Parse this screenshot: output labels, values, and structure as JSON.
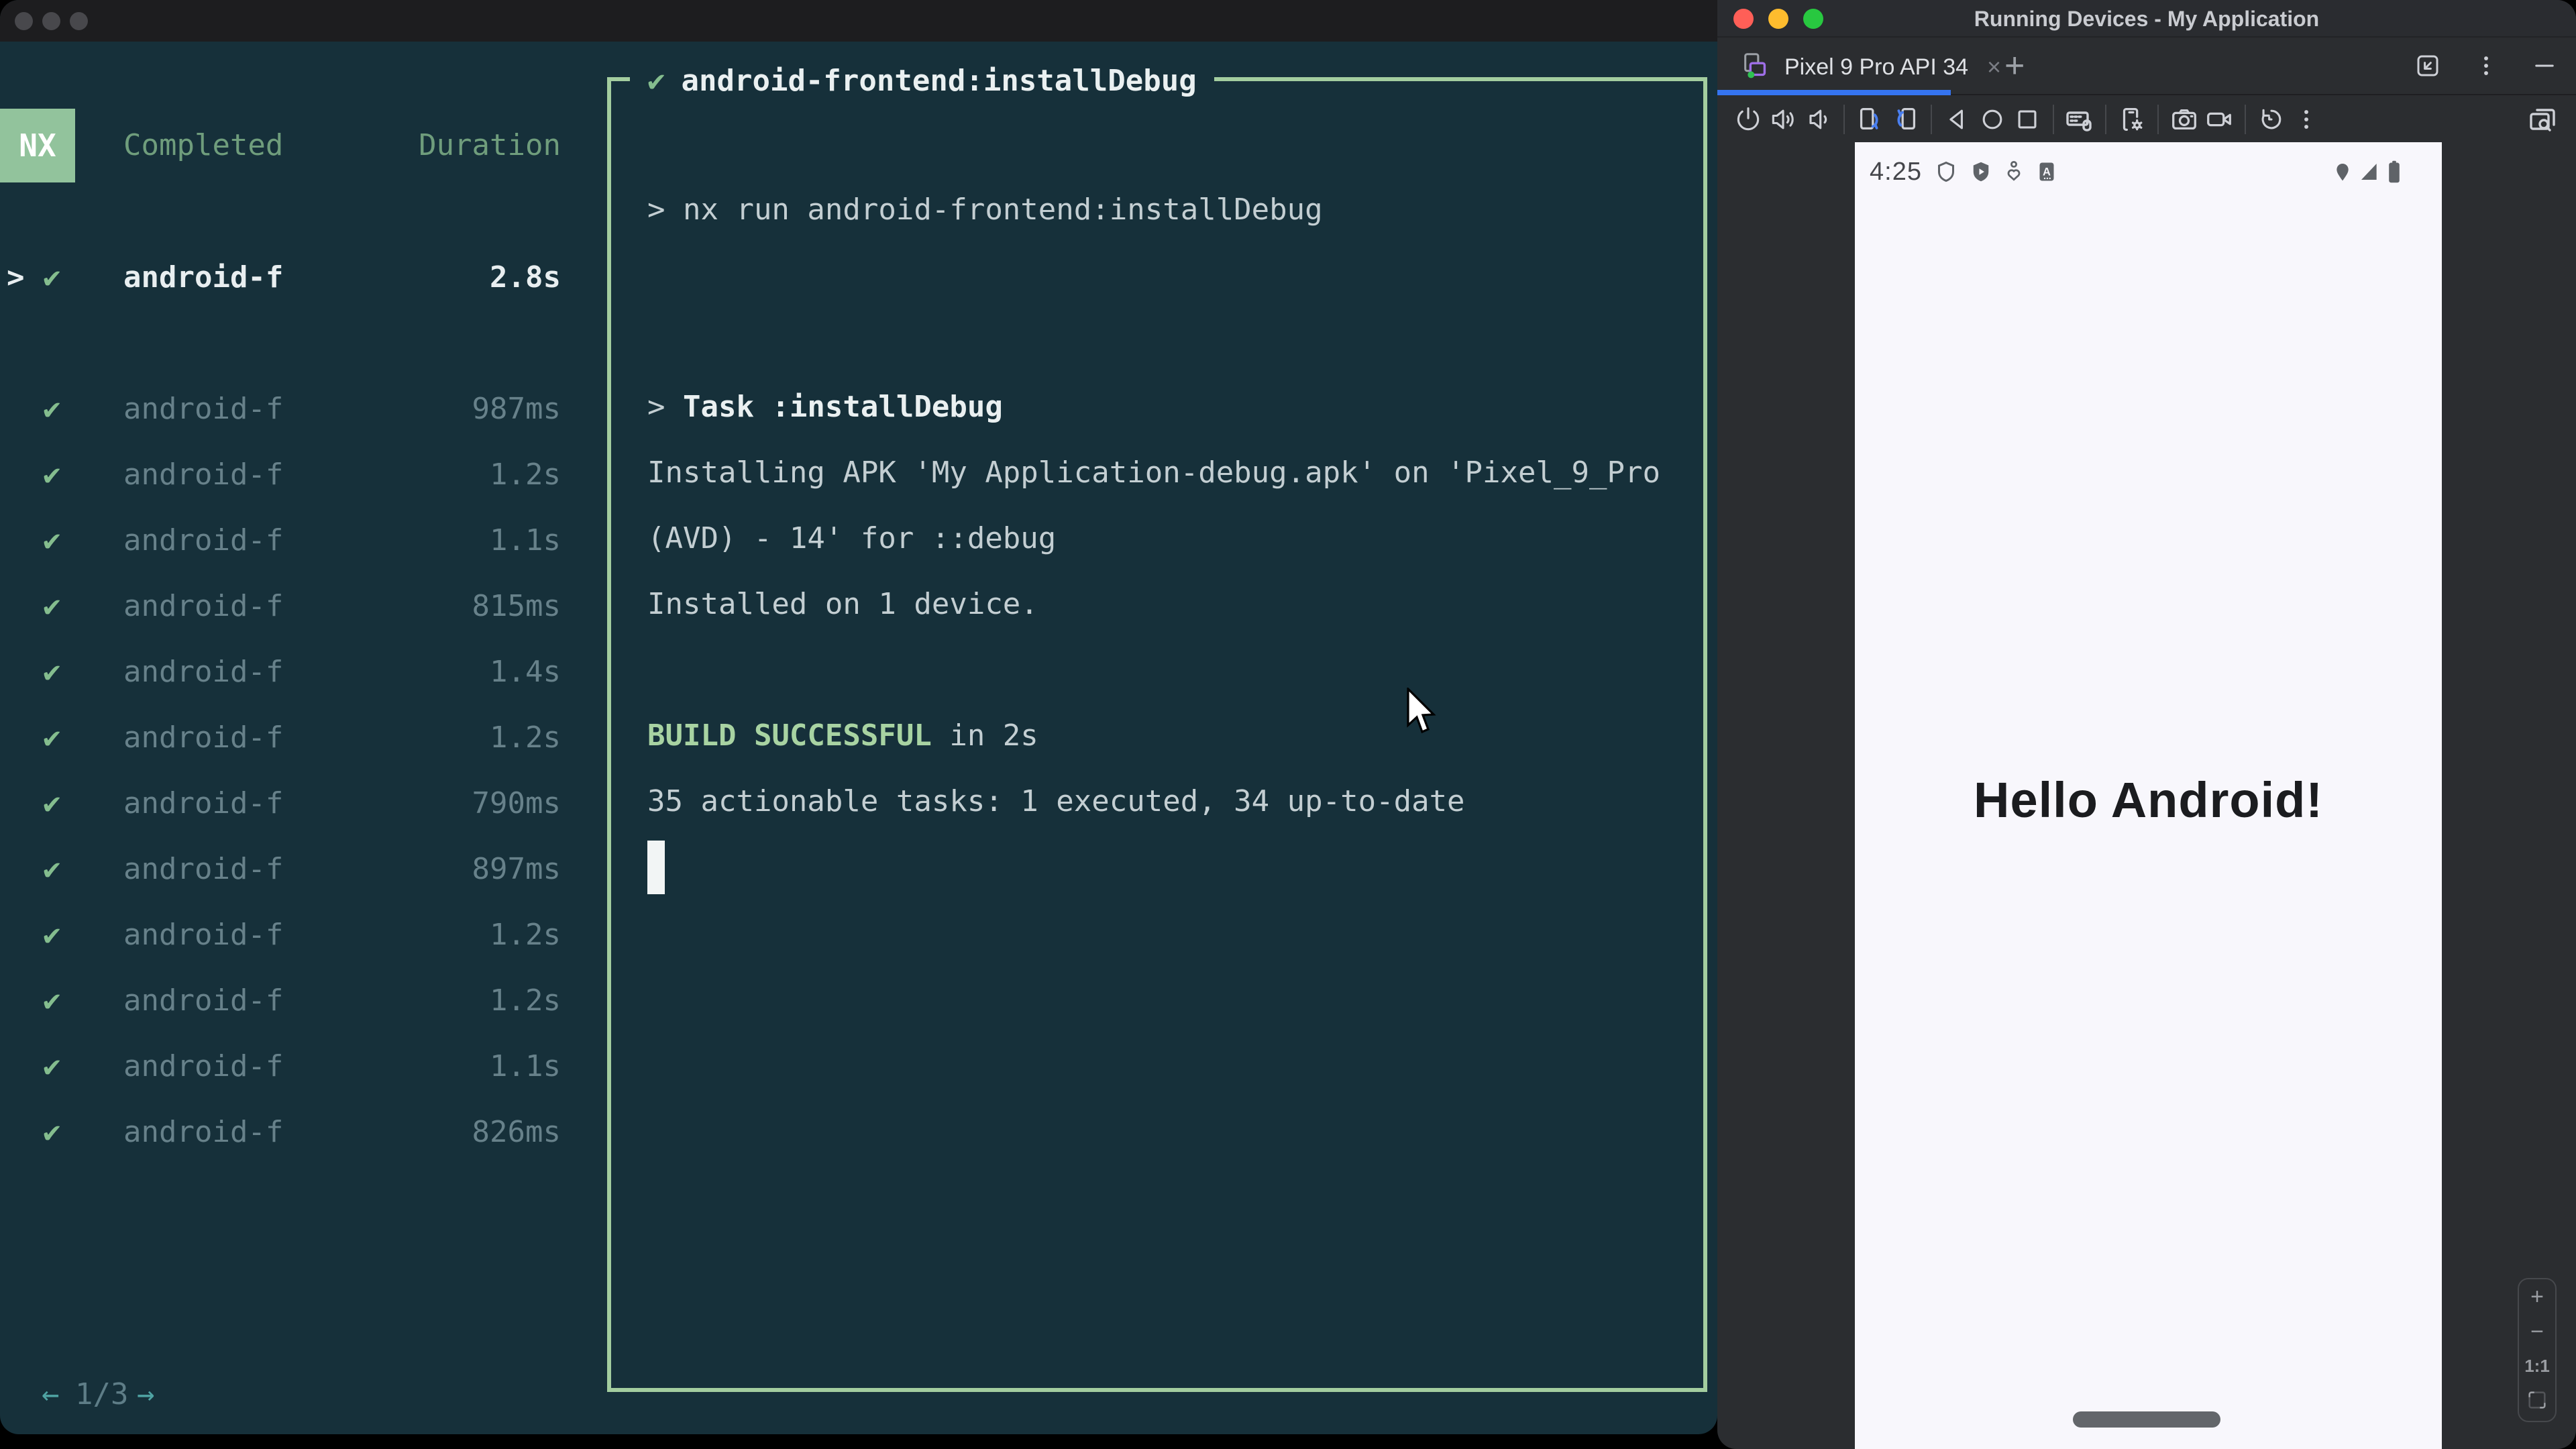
{
  "colors": {
    "terminal_bg": "#16303a",
    "accent_green_border": "#a3cd9f",
    "nx_badge_green": "#92c39c",
    "check_green": "#84bd8e",
    "build_success_green": "#a8d3a2",
    "pagination_teal": "#4fa3a3",
    "tab_underline_blue": "#3574f0",
    "studio_bg": "#2b2d30",
    "emulator_screen_bg": "#f8f7fc",
    "traffic_red": "#ff5f57",
    "traffic_yellow": "#febc2e",
    "traffic_green": "#28c840"
  },
  "left_window": {
    "terminal": {
      "logo": "NX",
      "columns": {
        "completed": "Completed",
        "duration": "Duration"
      },
      "caret_glyph": ">",
      "check_glyph": "✔",
      "selected_task": {
        "name": "android-f",
        "duration": "2.8s"
      },
      "tasks": [
        {
          "name": "android-f",
          "duration": "987ms"
        },
        {
          "name": "android-f",
          "duration": "1.2s"
        },
        {
          "name": "android-f",
          "duration": "1.1s"
        },
        {
          "name": "android-f",
          "duration": "815ms"
        },
        {
          "name": "android-f",
          "duration": "1.4s"
        },
        {
          "name": "android-f",
          "duration": "1.2s"
        },
        {
          "name": "android-f",
          "duration": "790ms"
        },
        {
          "name": "android-f",
          "duration": "897ms"
        },
        {
          "name": "android-f",
          "duration": "1.2s"
        },
        {
          "name": "android-f",
          "duration": "1.2s"
        },
        {
          "name": "android-f",
          "duration": "1.1s"
        },
        {
          "name": "android-f",
          "duration": "826ms"
        }
      ],
      "pagination": {
        "prev": "←",
        "current": "1/3",
        "next": "→"
      },
      "output": {
        "check": "✔",
        "title": "android-frontend:installDebug",
        "lines": [
          {
            "segments": []
          },
          {
            "segments": [
              {
                "text": "> nx run android-frontend:installDebug",
                "style": "fg"
              }
            ]
          },
          {
            "segments": []
          },
          {
            "segments": []
          },
          {
            "segments": [
              {
                "text": "> ",
                "style": "fg"
              },
              {
                "text": "Task :installDebug",
                "style": "white-bold"
              }
            ]
          },
          {
            "segments": [
              {
                "text": "Installing APK 'My Application-debug.apk' on 'Pixel_9_Pro",
                "style": "fg"
              }
            ]
          },
          {
            "segments": [
              {
                "text": "(AVD) - 14' for ::debug",
                "style": "fg"
              }
            ]
          },
          {
            "segments": [
              {
                "text": "Installed on 1 device.",
                "style": "fg"
              }
            ]
          },
          {
            "segments": []
          },
          {
            "segments": [
              {
                "text": "BUILD SUCCESSFUL",
                "style": "green-bold"
              },
              {
                "text": " in 2s",
                "style": "fg"
              }
            ]
          },
          {
            "segments": [
              {
                "text": "35 actionable tasks: 1 executed, 34 up-to-date",
                "style": "fg"
              }
            ]
          },
          {
            "segments": [],
            "cursor": true
          }
        ]
      }
    }
  },
  "right_window": {
    "titlebar": {
      "title": "Running Devices - My Application"
    },
    "tab_bar": {
      "active_tab": {
        "label": "Pixel 9 Pro API 34",
        "close": "×"
      },
      "add": "+",
      "window_icons": [
        "embed-window",
        "more-vertical",
        "hide"
      ]
    },
    "toolbar": {
      "icons": [
        "power",
        "volume-up",
        "volume-down",
        "sep",
        "rotate-left",
        "rotate-right",
        "sep",
        "back",
        "home",
        "overview",
        "sep",
        "keyboard",
        "sep",
        "device-settings",
        "sep",
        "camera",
        "screen-record",
        "sep",
        "reset",
        "more-vertical"
      ],
      "right_icon": "display-search"
    },
    "emulator": {
      "status_bar": {
        "time": "4:25",
        "left_icons": [
          "shield",
          "shield-play",
          "profile",
          "letter-a"
        ],
        "right_icons": [
          "location",
          "signal",
          "battery"
        ]
      },
      "content": {
        "greeting": "Hello Android!"
      }
    },
    "zoom_controls": {
      "zoom_in": "+",
      "zoom_out": "−",
      "actual_size": "1:1"
    }
  }
}
